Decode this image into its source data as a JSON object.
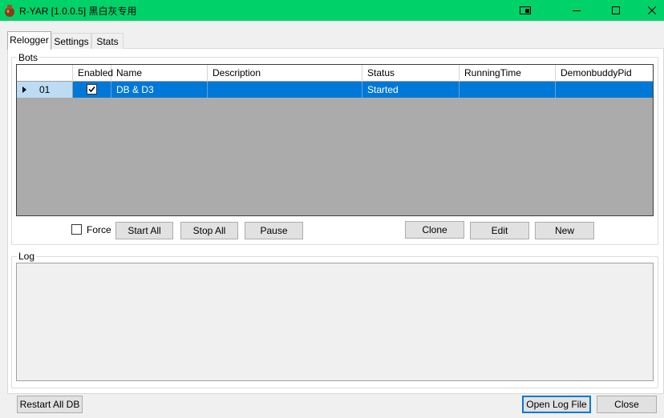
{
  "window": {
    "title": "R-YAR [1.0.0.5] 黑白灰专用",
    "titlebar_color": "#00d26a"
  },
  "tabs": [
    {
      "label": "Relogger",
      "active": true
    },
    {
      "label": "Settings",
      "active": false
    },
    {
      "label": "Stats",
      "active": false
    }
  ],
  "bots_group": {
    "label": "Bots",
    "columns": [
      "Enabled",
      "Name",
      "Description",
      "Status",
      "RunningTime",
      "DemonbuddyPid"
    ],
    "rows": [
      {
        "number": "01",
        "enabled": true,
        "name": "DB & D3",
        "description": "",
        "status": "Started",
        "running_time": "",
        "demonbuddy_pid": ""
      }
    ],
    "selection_color": "#0078d7",
    "force_label": "Force",
    "force_checked": false,
    "buttons": {
      "start_all": "Start All",
      "stop_all": "Stop All",
      "pause": "Pause",
      "clone": "Clone",
      "edit": "Edit",
      "new": "New"
    }
  },
  "log_group": {
    "label": "Log",
    "content": ""
  },
  "footer": {
    "restart_all": "Restart All DB",
    "open_log": "Open Log File",
    "close": "Close"
  }
}
